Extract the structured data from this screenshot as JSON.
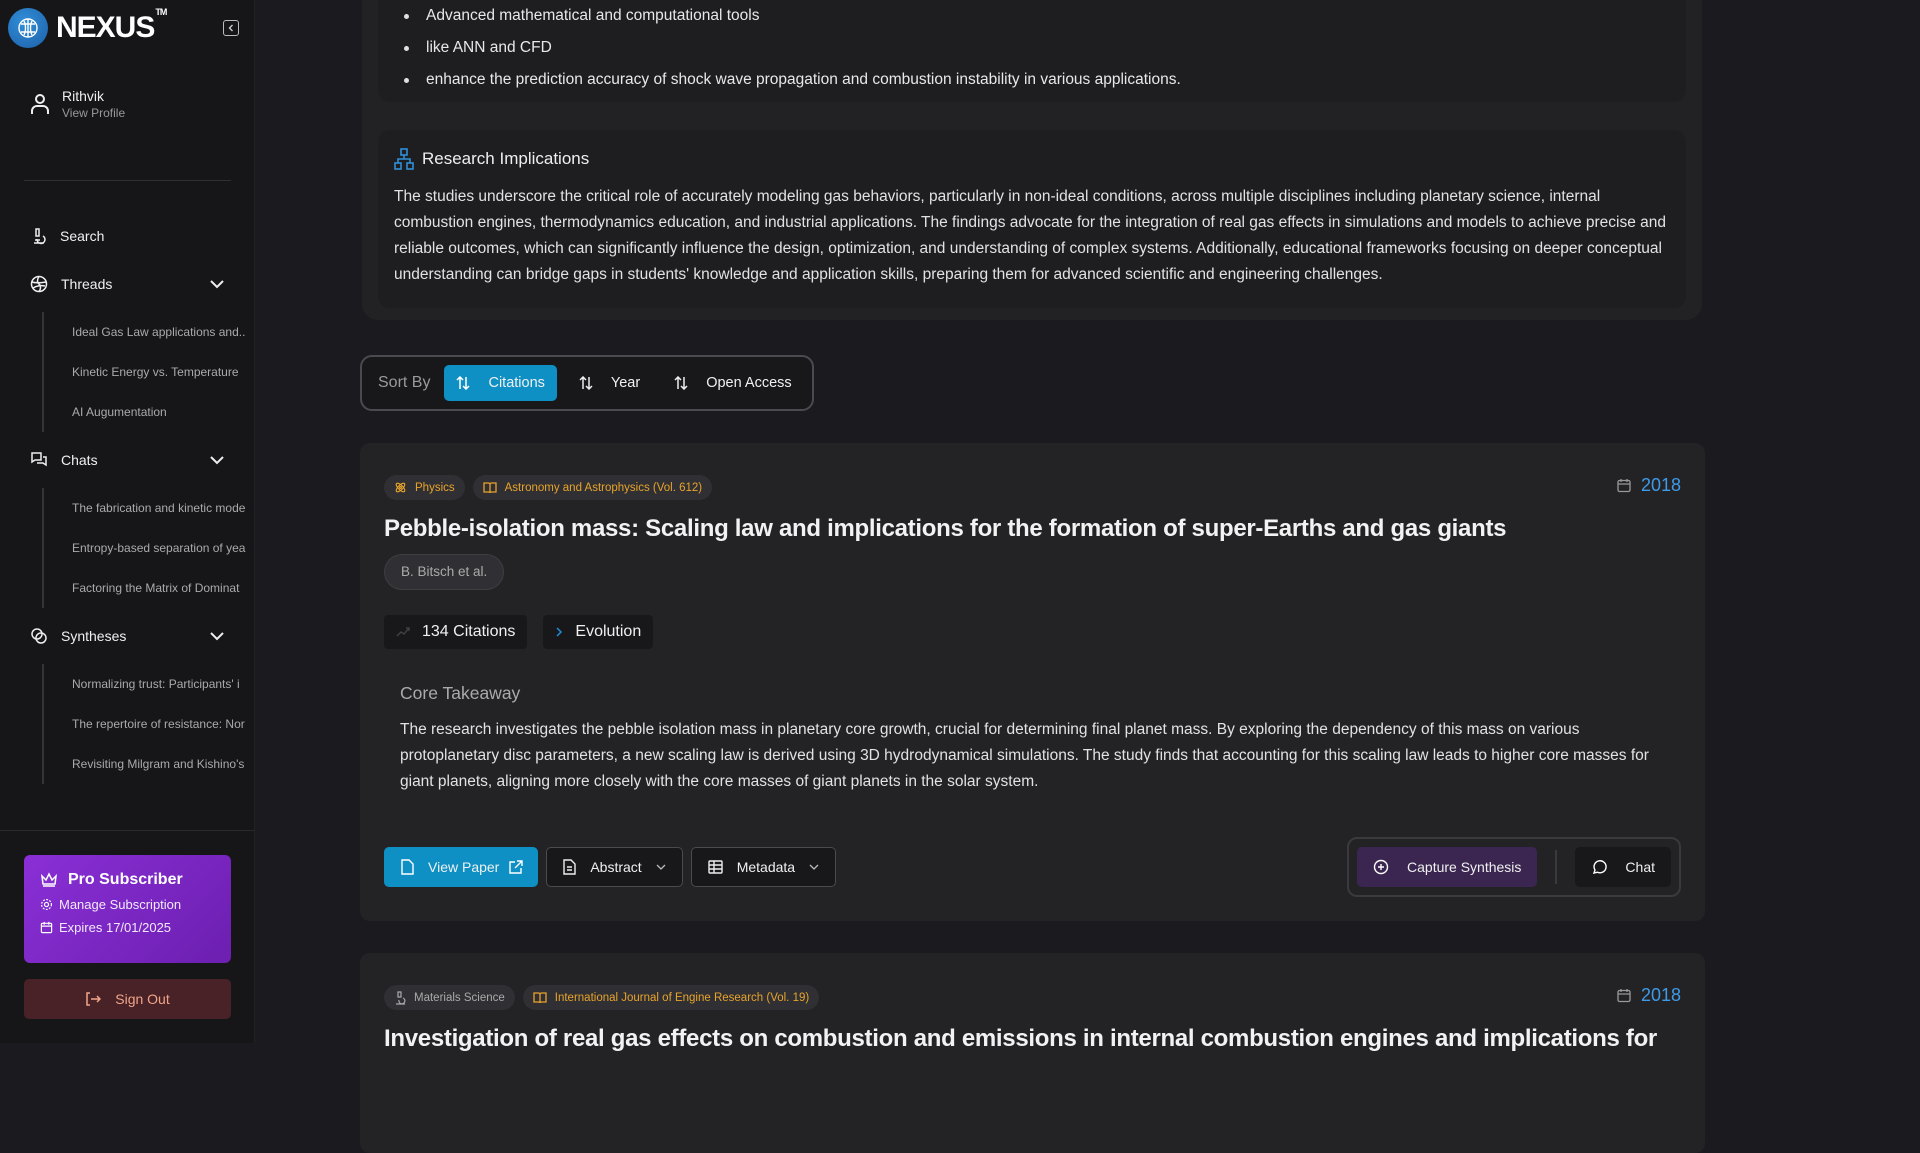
{
  "app": {
    "brand": "NEXUS",
    "trademark": "TM"
  },
  "profile": {
    "name": "Rithvik",
    "subtitle": "View Profile"
  },
  "nav": {
    "search": "Search",
    "threads": {
      "label": "Threads",
      "items": [
        "Ideal Gas Law applications and..",
        "Kinetic Energy vs. Temperature",
        "AI Augumentation"
      ]
    },
    "chats": {
      "label": "Chats",
      "items": [
        "The fabrication and kinetic mode",
        "Entropy-based separation of yea",
        "Factoring the Matrix of Dominat"
      ]
    },
    "syntheses": {
      "label": "Syntheses",
      "items": [
        "Normalizing trust: Participants' i",
        "The repertoire of resistance: Nor",
        "Revisiting Milgram and Kishino's"
      ]
    }
  },
  "subscription": {
    "title": "Pro Subscriber",
    "manage": "Manage Subscription",
    "expires": "Expires 17/01/2025"
  },
  "signout": "Sign Out",
  "summary": {
    "bullets": [
      "Advanced mathematical and computational tools",
      "like ANN and CFD",
      "enhance the prediction accuracy of shock wave propagation and combustion instability in various applications."
    ],
    "implications_title": "Research Implications",
    "implications_body": "The studies underscore the critical role of accurately modeling gas behaviors, particularly in non-ideal conditions, across multiple disciplines including planetary science, internal combustion engines, thermodynamics education, and industrial applications. The findings advocate for the integration of real gas effects in simulations and models to achieve precise and reliable outcomes, which can significantly influence the design, optimization, and understanding of complex systems. Additionally, educational frameworks focusing on deeper conceptual understanding can bridge gaps in students' knowledge and application skills, preparing them for advanced scientific and engineering challenges."
  },
  "sort": {
    "label": "Sort By",
    "options": [
      "Citations",
      "Year",
      "Open Access"
    ],
    "active": "Citations"
  },
  "papers": [
    {
      "field": "Physics",
      "journal": "Astronomy and Astrophysics (Vol. 612)",
      "year": "2018",
      "title": "Pebble-isolation mass: Scaling law and implications for the formation of super-Earths and gas giants",
      "authors": "B. Bitsch et al.",
      "citations": "134 Citations",
      "evolution": "Evolution",
      "core_title": "Core Takeaway",
      "core_body": "The research investigates the pebble isolation mass in planetary core growth, crucial for determining final planet mass. By exploring the dependency of this mass on various protoplanetary disc parameters, a new scaling law is derived using 3D hydrodynamical simulations. The study finds that accounting for this scaling law leads to higher core masses for giant planets, aligning more closely with the core masses of giant planets in the solar system.",
      "actions": {
        "view": "View Paper",
        "abstract": "Abstract",
        "metadata": "Metadata",
        "synthesis": "Capture Synthesis",
        "chat": "Chat"
      }
    },
    {
      "field": "Materials Science",
      "journal": "International Journal of Engine Research (Vol. 19)",
      "year": "2018",
      "title": "Investigation of real gas effects on combustion and emissions in internal combustion engines and implications for"
    }
  ],
  "colors": {
    "accent": "#0e90c4",
    "year": "#3f9be8",
    "tag": "#e8a32a",
    "pro": "#7b27c4",
    "signout_bg": "#482226"
  }
}
